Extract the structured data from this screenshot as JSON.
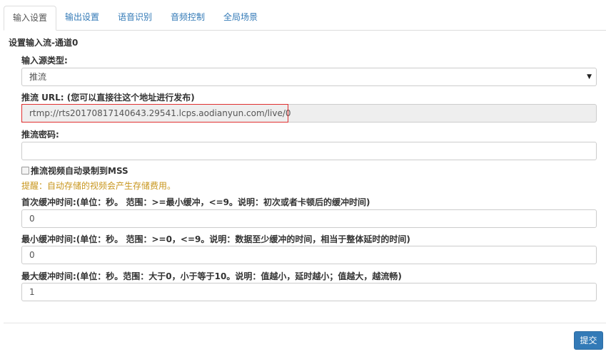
{
  "tabs": [
    {
      "label": "输入设置",
      "active": true
    },
    {
      "label": "输出设置",
      "active": false
    },
    {
      "label": "语音识别",
      "active": false
    },
    {
      "label": "音频控制",
      "active": false
    },
    {
      "label": "全局场景",
      "active": false
    }
  ],
  "section_title": "设置输入流-通道0",
  "input_source": {
    "label": "输入源类型:",
    "value": "推流"
  },
  "push_url": {
    "label": "推流 URL: (您可以直接往这个地址进行发布)",
    "value": "rtmp://rts20170817140643.29541.lcps.aodianyun.com/live/0"
  },
  "push_password": {
    "label": "推流密码:",
    "value": ""
  },
  "auto_record": {
    "label": "推流视频自动录制到MSS",
    "checked": false
  },
  "hint": "提醒：自动存储的视频会产生存储费用。",
  "first_buffer": {
    "label": "首次缓冲时间:(单位：秒。 范围：>=最小缓冲，<=9。说明：初次或者卡顿后的缓冲时间)",
    "value": "0"
  },
  "min_buffer": {
    "label": "最小缓冲时间:(单位：秒。 范围：>=0，<=9。说明：数据至少缓冲的时间，相当于整体延时的时间)",
    "value": "0"
  },
  "max_buffer": {
    "label": "最大缓冲时间:(单位：秒。范围：大于0，小于等于10。说明：值越小，延时越小；值越大，越流畅)",
    "value": "1"
  },
  "submit_label": "提交",
  "colors": {
    "accent": "#337ab7",
    "hint": "#c8961e",
    "highlight": "#e03030"
  }
}
